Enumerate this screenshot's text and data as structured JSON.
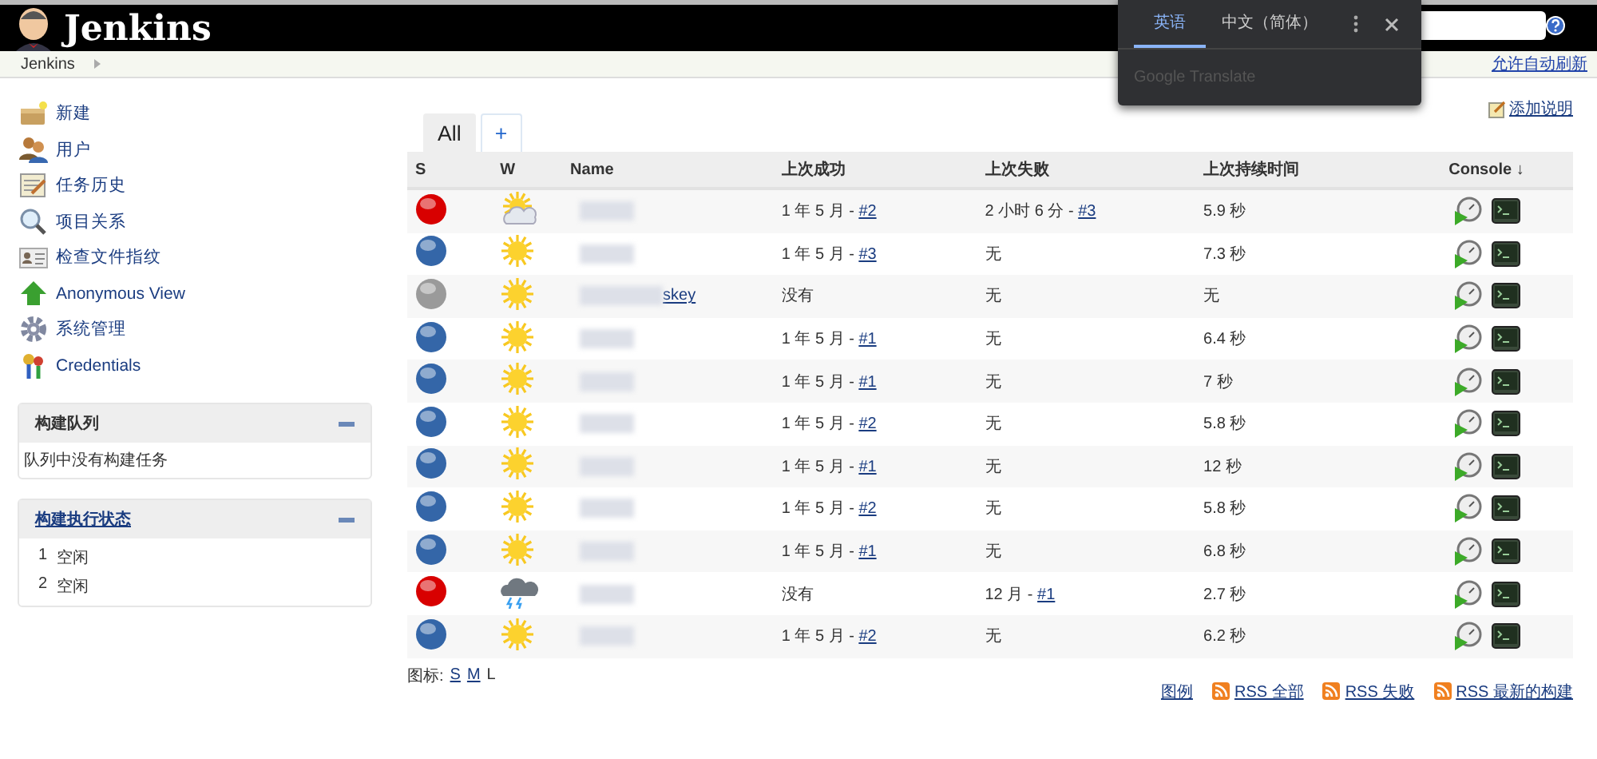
{
  "header": {
    "title": "Jenkins"
  },
  "translate_popup": {
    "tabs": [
      {
        "label": "英语",
        "selected": true
      },
      {
        "label": "中文（简体）",
        "selected": false
      }
    ],
    "footer": "Google Translate"
  },
  "breadcrumb": [
    "Jenkins"
  ],
  "auto_refresh_link": "允许自动刷新",
  "sidebar": {
    "items": [
      {
        "label": "新建",
        "kind": "new"
      },
      {
        "label": "用户",
        "kind": "users"
      },
      {
        "label": "任务历史",
        "kind": "history"
      },
      {
        "label": "项目关系",
        "kind": "search"
      },
      {
        "label": "检查文件指纹",
        "kind": "fingerprint"
      },
      {
        "label": "Anonymous View",
        "kind": "up"
      },
      {
        "label": "系统管理",
        "kind": "gear"
      },
      {
        "label": "Credentials",
        "kind": "key"
      }
    ]
  },
  "build_queue": {
    "title": "构建队列",
    "message": "队列中没有构建任务"
  },
  "executors": {
    "title": "构建执行状态",
    "items": [
      {
        "number": "1",
        "status": "空闲"
      },
      {
        "number": "2",
        "status": "空闲"
      }
    ]
  },
  "add_description": "添加说明",
  "view_tabs": [
    {
      "label": "All",
      "selected": true
    },
    {
      "label": "+",
      "selected": false
    }
  ],
  "table": {
    "columns": [
      "S",
      "W",
      "Name",
      "上次成功",
      "上次失败",
      "上次持续时间",
      "Console ↓"
    ],
    "rows": [
      {
        "color": "#d80000",
        "kind": "cloudy",
        "success": {
          "text": "1 年 5 月 - ",
          "link": "#2"
        },
        "failure": {
          "text": "2 小时 6 分 - ",
          "link": "#3"
        },
        "duration": "5.9 秒"
      },
      {
        "color": "#3466a8",
        "kind": "sunny",
        "success": {
          "text": "1 年 5 月 - ",
          "link": "#3"
        },
        "failure": {
          "text": "无"
        },
        "duration": "7.3 秒"
      },
      {
        "color": "#9a9a9a",
        "kind": "sunny",
        "name": "skey",
        "success": {
          "text": "没有"
        },
        "failure": {
          "text": "无"
        },
        "duration": "无"
      },
      {
        "color": "#3466a8",
        "kind": "sunny",
        "success": {
          "text": "1 年 5 月 - ",
          "link": "#1"
        },
        "failure": {
          "text": "无"
        },
        "duration": "6.4 秒"
      },
      {
        "color": "#3466a8",
        "kind": "sunny",
        "success": {
          "text": "1 年 5 月 - ",
          "link": "#1"
        },
        "failure": {
          "text": "无"
        },
        "duration": "7 秒"
      },
      {
        "color": "#3466a8",
        "kind": "sunny",
        "success": {
          "text": "1 年 5 月 - ",
          "link": "#2"
        },
        "failure": {
          "text": "无"
        },
        "duration": "5.8 秒"
      },
      {
        "color": "#3466a8",
        "kind": "sunny",
        "success": {
          "text": "1 年 5 月 - ",
          "link": "#1"
        },
        "failure": {
          "text": "无"
        },
        "duration": "12 秒"
      },
      {
        "color": "#3466a8",
        "kind": "sunny",
        "success": {
          "text": "1 年 5 月 - ",
          "link": "#2"
        },
        "failure": {
          "text": "无"
        },
        "duration": "5.8 秒"
      },
      {
        "color": "#3466a8",
        "kind": "sunny",
        "success": {
          "text": "1 年 5 月 - ",
          "link": "#1"
        },
        "failure": {
          "text": "无"
        },
        "duration": "6.8 秒"
      },
      {
        "color": "#d80000",
        "kind": "storm",
        "success": {
          "text": "没有"
        },
        "failure": {
          "text": "12 月 - ",
          "link": "#1"
        },
        "duration": "2.7 秒"
      },
      {
        "color": "#3466a8",
        "kind": "sunny",
        "success": {
          "text": "1 年 5 月 - ",
          "link": "#2"
        },
        "failure": {
          "text": "无"
        },
        "duration": "6.2 秒"
      }
    ]
  },
  "icon_size": {
    "label": "图标:",
    "options": [
      {
        "label": "S",
        "selected": false
      },
      {
        "label": "M",
        "selected": false
      },
      {
        "label": "L",
        "selected": true
      }
    ]
  },
  "footer_links": [
    "图例",
    "RSS 全部",
    "RSS 失败",
    "RSS 最新的构建"
  ]
}
